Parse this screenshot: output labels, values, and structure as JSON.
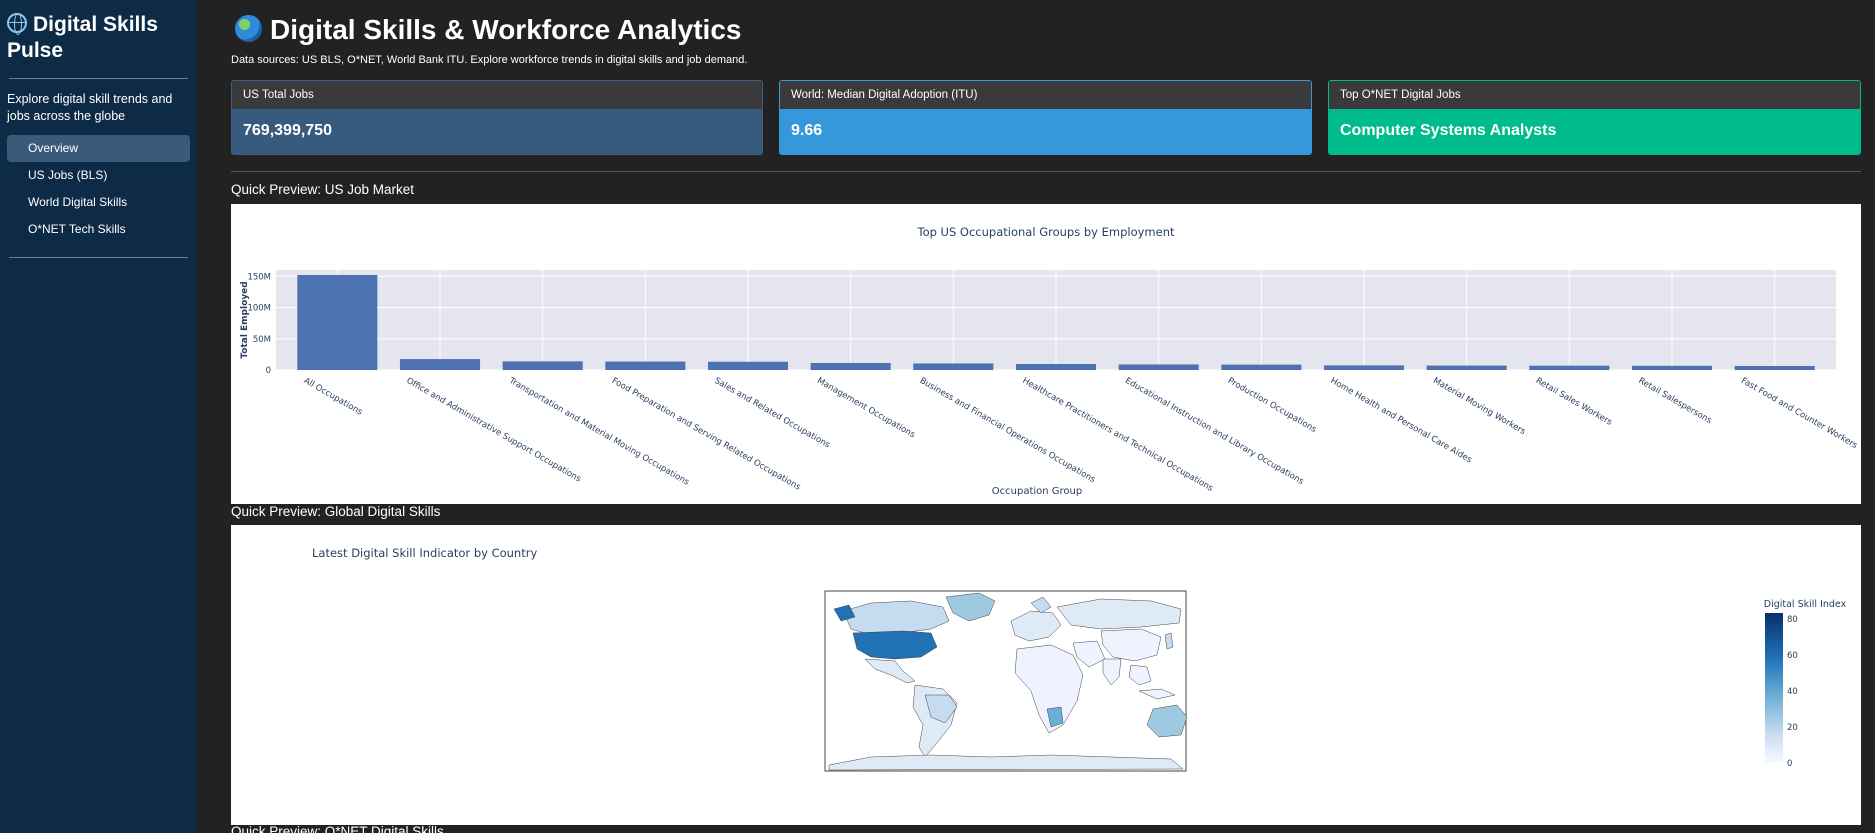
{
  "sidebar": {
    "brand": "Digital Skills Pulse",
    "description": "Explore digital skill trends and jobs across the globe",
    "nav": [
      {
        "label": "Overview",
        "active": true
      },
      {
        "label": "US Jobs (BLS)",
        "active": false
      },
      {
        "label": "World Digital Skills",
        "active": false
      },
      {
        "label": "O*NET Tech Skills",
        "active": false
      }
    ]
  },
  "header": {
    "title": "Digital Skills & Workforce Analytics",
    "subtitle": "Data sources: US BLS, O*NET, World Bank ITU. Explore workforce trends in digital skills and job demand."
  },
  "cards": [
    {
      "header": "US Total Jobs",
      "value": "769,399,750"
    },
    {
      "header": "World: Median Digital Adoption (ITU)",
      "value": "9.66"
    },
    {
      "header": "Top O*NET Digital Jobs",
      "value": "Computer Systems Analysts"
    }
  ],
  "sections": {
    "us_jobs": "Quick Preview: US Job Market",
    "global": "Quick Preview: Global Digital Skills",
    "onet": "Quick Preview: O*NET Digital Skills"
  },
  "colors": {
    "bar": "#4c72b0",
    "plot_bg": "#e5e5f0",
    "card1": "#375a7f",
    "card2": "#3498db",
    "card3": "#00bc8c",
    "sidebar_bg": "#0d2a47"
  },
  "chart_data": [
    {
      "type": "bar",
      "title": "Top US Occupational Groups by Employment",
      "xlabel": "Occupation Group",
      "ylabel": "Total Employed",
      "ylim": [
        0,
        160000000
      ],
      "yticks": [
        {
          "value": 0,
          "label": "0"
        },
        {
          "value": 50000000,
          "label": "50M"
        },
        {
          "value": 100000000,
          "label": "100M"
        },
        {
          "value": 150000000,
          "label": "150M"
        }
      ],
      "grid": true,
      "categories": [
        "All Occupations",
        "Office and Administrative Support Occupations",
        "Transportation and Material Moving Occupations",
        "Food Preparation and Serving Related Occupations",
        "Sales and Related Occupations",
        "Management Occupations",
        "Business and Financial Operations Occupations",
        "Healthcare Practitioners and Technical Occupations",
        "Educational Instruction and Library Occupations",
        "Production Occupations",
        "Home Health and Personal Care Aides",
        "Material Moving Workers",
        "Retail Sales Workers",
        "Retail Salespersons",
        "Fast Food and Counter Workers"
      ],
      "values": [
        152000000,
        17500000,
        13800000,
        13500000,
        13200000,
        11200000,
        10500000,
        9600000,
        8900000,
        8600000,
        7400000,
        7100000,
        6900000,
        6700000,
        6400000
      ]
    },
    {
      "type": "choropleth",
      "title": "Latest Digital Skill Indicator by Country",
      "colorbar_title": "Digital Skill Index",
      "colorbar_ticks": [
        "80",
        "60",
        "40",
        "20",
        "0"
      ],
      "colorscale": [
        "#f7fbff",
        "#c6dbef",
        "#6baed6",
        "#2171b5",
        "#08306b"
      ]
    }
  ]
}
